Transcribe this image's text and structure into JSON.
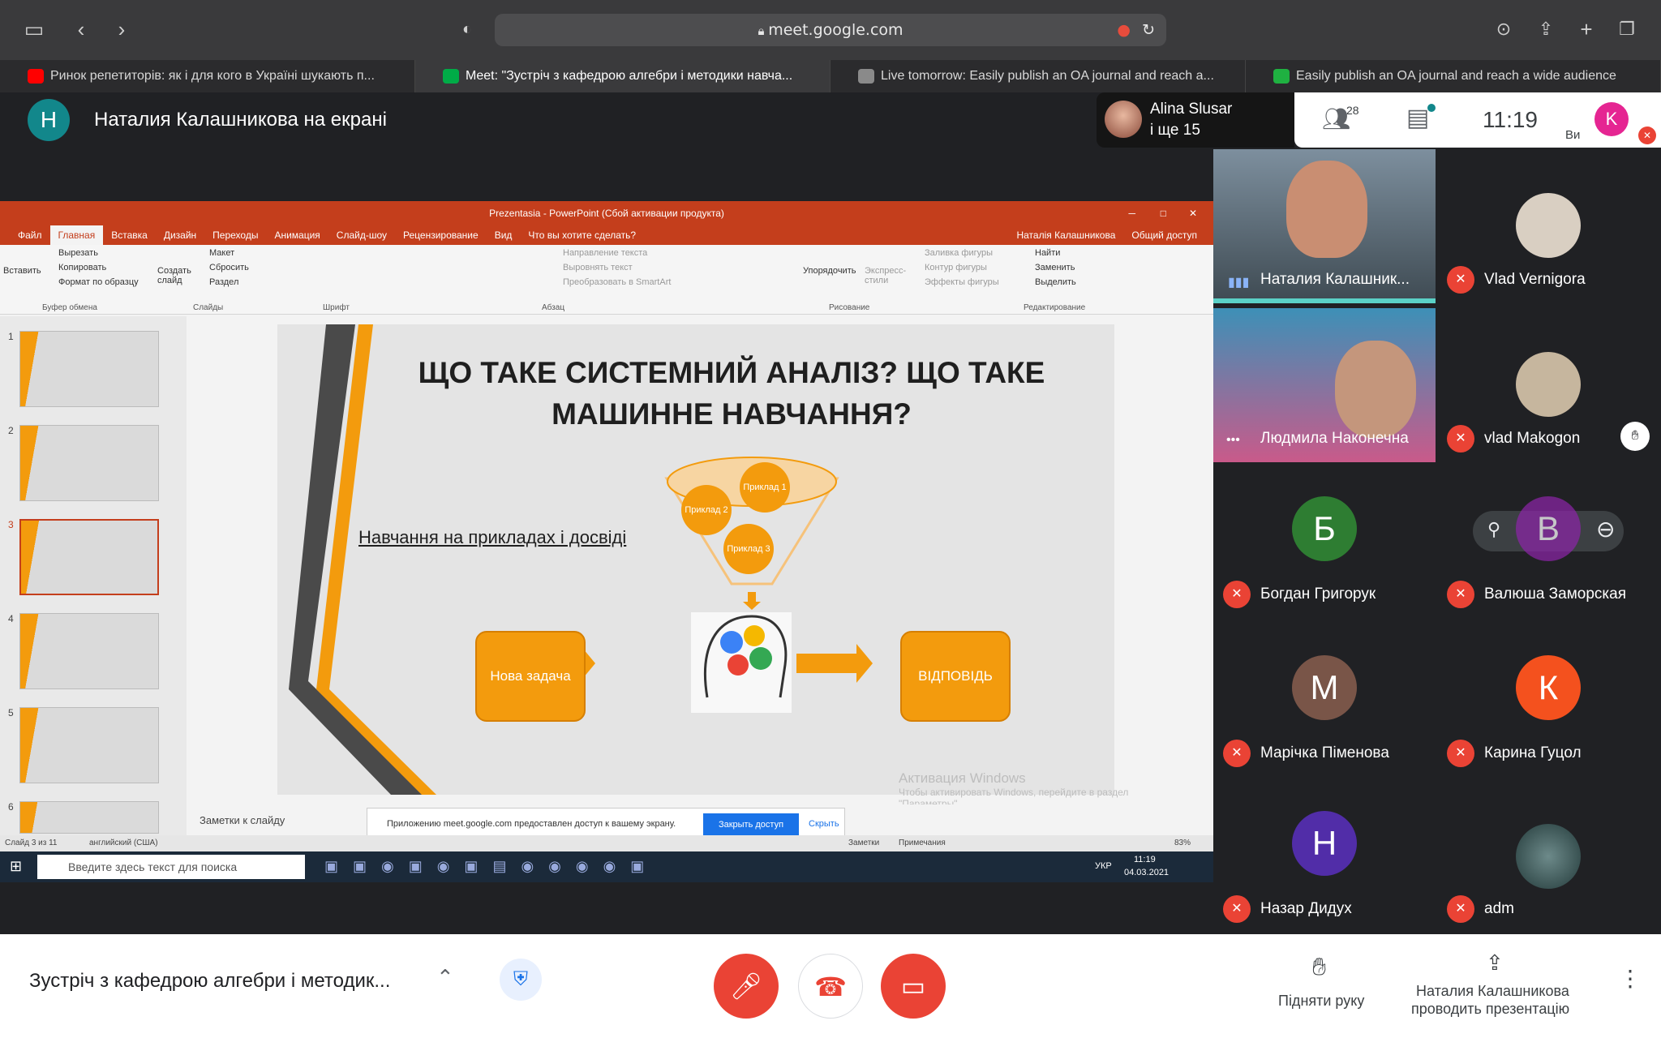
{
  "browser": {
    "url": "meet.google.com",
    "tabs": [
      {
        "label": "Ринок репетиторів: як і для кого в Україні шукають п...",
        "favicon_color": "#ff0000"
      },
      {
        "label": "Meet: \"Зустріч з кафедрою алгебри і методики навча...",
        "favicon_color": "#00ac47"
      },
      {
        "label": "Live tomorrow: Easily publish an OA journal and reach a...",
        "favicon_color": "#8a8a8a"
      },
      {
        "label": "Easily publish an OA journal and reach a wide audience",
        "favicon_color": "#1fb141"
      }
    ]
  },
  "meet": {
    "presenter_initial": "Н",
    "presenter_label": "Наталия Калашникова на екрані",
    "speaker_name": "Alina Slusar",
    "speaker_more": "і ще 15",
    "people_count": "28",
    "time": "11:19",
    "self_initial": "K",
    "self_label": "Ви",
    "meeting_title": "Зустріч з кафедрою алгебри і методик...",
    "raise_hand": "Підняти руку",
    "presenting_line1": "Наталия Калашникова",
    "presenting_line2": "проводить презентацію"
  },
  "participants": [
    {
      "name": "Наталия Калашник...",
      "type": "video"
    },
    {
      "name": "Vlad Vernigora",
      "type": "photo"
    },
    {
      "name": "Людмила Наконечна",
      "type": "video"
    },
    {
      "name": "vlad Makogon",
      "type": "photo"
    },
    {
      "name": "Богдан Григорук",
      "initial": "Б",
      "color": "#2e7d32"
    },
    {
      "name": "Валюша Заморская",
      "initial": "В",
      "color": "#8e24aa"
    },
    {
      "name": "Марічка Піменова",
      "initial": "М",
      "color": "#795548"
    },
    {
      "name": "Карина Гуцол",
      "initial": "К",
      "color": "#f4511e"
    },
    {
      "name": "Назар Дидух",
      "initial": "Н",
      "color": "#512da8"
    },
    {
      "name": "adm",
      "type": "photo"
    }
  ],
  "ppt": {
    "window_title": "Prezentasia - PowerPoint (Сбой активации продукта)",
    "user": "Наталія Калашникова",
    "share": "Общий доступ",
    "menu": [
      "Файл",
      "Главная",
      "Вставка",
      "Дизайн",
      "Переходы",
      "Анимация",
      "Слайд-шоу",
      "Рецензирование",
      "Вид",
      "Что вы хотите сделать?"
    ],
    "ribbon_groups": [
      "Буфер обмена",
      "Слайды",
      "Шрифт",
      "Абзац",
      "Рисование",
      "Редактирование"
    ],
    "ribbon_items": {
      "paste": "Вставить",
      "cut": "Вырезать",
      "copy": "Копировать",
      "format": "Формат по образцу",
      "create": "Создать слайд",
      "layout": "Макет",
      "reset": "Сбросить",
      "section": "Раздел",
      "text_dir": "Направление текста",
      "align_text": "Выровнять текст",
      "smartart": "Преобразовать в SmartArt",
      "arrange": "Упорядочить",
      "express": "Экспресс-стили",
      "fill": "Заливка фигуры",
      "outline": "Контур фигуры",
      "effects": "Эффекты фигуры",
      "find": "Найти",
      "replace": "Заменить",
      "select": "Выделить"
    },
    "slide_numbers": [
      "1",
      "2",
      "3",
      "4",
      "5",
      "6"
    ],
    "slide_title": "ЩО ТАКЕ СИСТЕМНИЙ АНАЛІЗ? ЩО ТАКЕ МАШИННЕ НАВЧАННЯ?",
    "bullet": "Навчання на прикладах і досвіді",
    "funnel_items": [
      "Приклад 2",
      "Приклад 1",
      "Приклад 3"
    ],
    "box_left": "Нова задача",
    "box_right": "ВІДПОВІДЬ",
    "notes": "Заметки к слайду",
    "status_slide": "Слайд 3 из 11",
    "status_lang": "английский (США)",
    "status_notes": "Заметки",
    "status_comments": "Примечания",
    "zoom": "83%",
    "activation_1": "Активация Windows",
    "activation_2": "Чтобы активировать Windows, перейдите в раздел",
    "activation_3": "\"Параметры\".",
    "share_notice": "Приложению meet.google.com предоставлен доступ к вашему экрану.",
    "share_stop": "Закрыть доступ",
    "share_hide": "Скрыть",
    "taskbar_search": "Введите здесь текст для поиска",
    "taskbar_time": "11:19",
    "taskbar_date": "04.03.2021",
    "taskbar_lang": "УКР"
  },
  "colors": {
    "meet_bg": "#202124",
    "red": "#ea4335",
    "ppt_red": "#c43e1c",
    "orange": "#f39b0d"
  }
}
